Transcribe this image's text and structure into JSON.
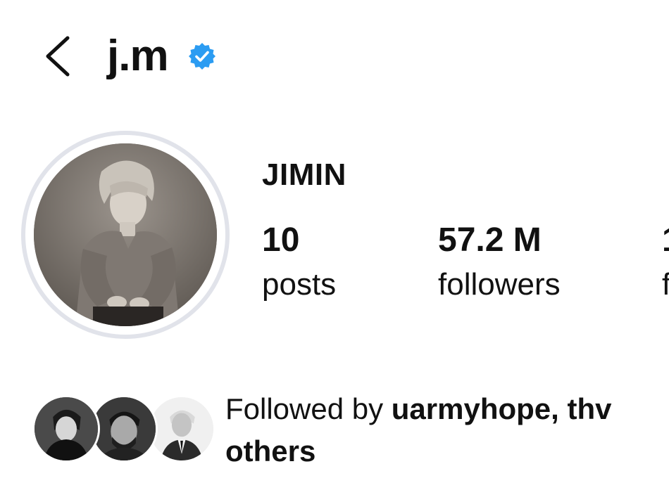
{
  "header": {
    "username": "j.m",
    "verified": true,
    "back_icon": "chevron-left-icon",
    "verified_icon": "verified-badge-icon",
    "verified_color": "#2b9cf2"
  },
  "profile": {
    "display_name": "JIMIN",
    "stats": {
      "posts_value": "10",
      "posts_label": "posts",
      "followers_value": "57.2 M",
      "followers_label": "followers",
      "following_value": "1",
      "following_label": "f"
    }
  },
  "followed_by": {
    "prefix": "Followed by ",
    "names": "uarmyhope, thv",
    "suffix": "others"
  }
}
